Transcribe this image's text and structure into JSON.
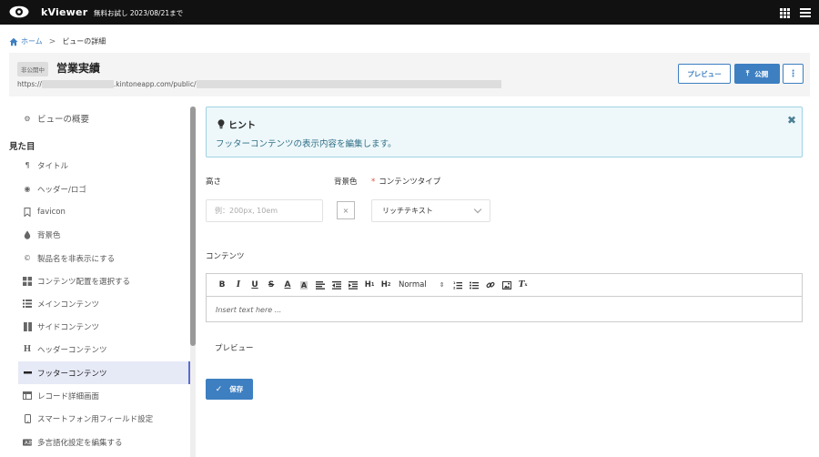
{
  "topbar": {
    "app_name": "kViewer",
    "trial_text": "無料お試し 2023/08/21まで"
  },
  "breadcrumb": {
    "home": "ホーム",
    "separator": ">",
    "current": "ビューの詳細"
  },
  "header": {
    "badge": "非公開中",
    "title": "営業実績",
    "url_prefix": "https://",
    "url_domain": ".kintoneapp.com/public/",
    "preview_label": "プレビュー",
    "publish_label": "公開",
    "more_label": "⋮"
  },
  "sidebar": {
    "overview_label": "ビューの概要",
    "section_label": "見た目",
    "items": [
      {
        "label": "タイトル",
        "icon": "paragraph-icon"
      },
      {
        "label": "ヘッダー/ロゴ",
        "icon": "eye-icon"
      },
      {
        "label": "favicon",
        "icon": "bookmark-icon"
      },
      {
        "label": "背景色",
        "icon": "drop-icon"
      },
      {
        "label": "製品名を非表示にする",
        "icon": "copyright-icon"
      },
      {
        "label": "コンテンツ配置を選択する",
        "icon": "grid-icon"
      },
      {
        "label": "メインコンテンツ",
        "icon": "list-icon"
      },
      {
        "label": "サイドコンテンツ",
        "icon": "columns-icon"
      },
      {
        "label": "ヘッダーコンテンツ",
        "icon": "heading-icon"
      },
      {
        "label": "フッターコンテンツ",
        "icon": "dash-icon"
      },
      {
        "label": "レコード詳細画面",
        "icon": "table-icon"
      },
      {
        "label": "スマートフォン用フィールド設定",
        "icon": "mobile-icon"
      },
      {
        "label": "多言語化設定を編集する",
        "icon": "language-icon"
      }
    ],
    "active_index": 9
  },
  "hint": {
    "title": "ヒント",
    "text": "フッターコンテンツの表示内容を編集します。",
    "close": "✖"
  },
  "form": {
    "height_label": "高さ",
    "height_placeholder": "例：200px, 10em",
    "bgcolor_label": "背景色",
    "bgcolor_clear": "×",
    "content_type_label": "コンテンツタイプ",
    "required_mark": "*",
    "content_type_value": "リッチテキスト",
    "content_label": "コンテンツ",
    "editor_placeholder": "Insert text here ...",
    "format_value": "Normal",
    "preview_label": "プレビュー",
    "save_label": "保存"
  },
  "colors": {
    "topbar": "#111111",
    "accent": "#3d7fc1",
    "hint_bg": "#eef8fb",
    "active_item": "#e6e9f6"
  }
}
